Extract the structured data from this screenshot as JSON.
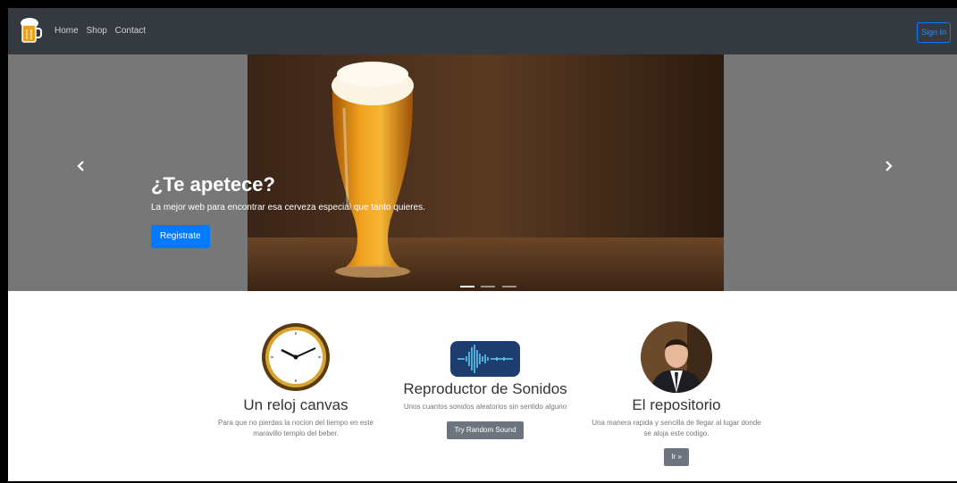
{
  "nav": {
    "links": [
      "Home",
      "Shop",
      "Contact"
    ],
    "signin": "Sign In"
  },
  "carousel": {
    "title": "¿Te apetece?",
    "subtitle": "La mejor web para encontrar esa cerveza especial que tanto quieres.",
    "cta": "Registrate",
    "prev_icon": "chevron-left-icon",
    "next_icon": "chevron-right-icon",
    "slides": 3,
    "active_slide": 1
  },
  "features": [
    {
      "title": "Un reloj canvas",
      "text": "Para que no pierdas la nocion del tiempo en este maravillo templo del beber.",
      "button": "",
      "icon": "clock-icon"
    },
    {
      "title": "Reproductor de Sonidos",
      "text": "Unos cuantos sonidos aleatorios sin sentido alguno",
      "button": "Try Random Sound",
      "icon": "sound-wave-icon"
    },
    {
      "title": "El repositorio",
      "text": "Una manera rapida y sencilla de llegar al lugar donde se aloja este codigo.",
      "button": "Ir »",
      "icon": "avatar"
    }
  ],
  "colors": {
    "navbar": "#343a40",
    "primary": "#007bff",
    "secondary": "#6c757d",
    "carousel_bg": "#777777"
  }
}
